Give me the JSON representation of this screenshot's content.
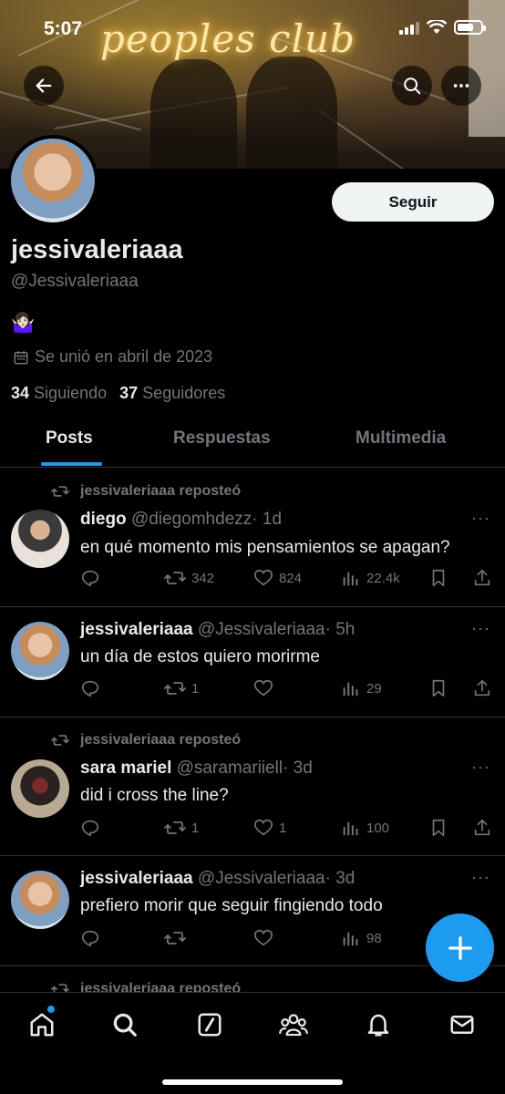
{
  "status_bar": {
    "time": "5:07"
  },
  "banner": {
    "neon_text": "peoples club"
  },
  "profile": {
    "display_name": "jessivaleriaaa",
    "handle": "@Jessivaleriaaa",
    "bio_emoji": "🤷🏻‍♀️",
    "joined": "Se unió en abril de 2023",
    "following_count": "34",
    "following_label": "Siguiendo",
    "followers_count": "37",
    "followers_label": "Seguidores",
    "follow_label": "Seguir"
  },
  "tabs": [
    {
      "label": "Posts",
      "active": true
    },
    {
      "label": "Respuestas",
      "active": false
    },
    {
      "label": "Multimedia",
      "active": false
    }
  ],
  "posts": [
    {
      "repost_by": "jessivaleriaaa reposteó",
      "name": "diego",
      "handle": "@diegomhdezz",
      "time": "· 1d",
      "text": "en qué momento mis pensamientos se apagan?",
      "replies": "",
      "reposts": "342",
      "likes": "824",
      "views": "22.4k"
    },
    {
      "repost_by": "",
      "name": "jessivaleriaaa",
      "handle": "@Jessivaleriaaa",
      "time": "· 5h",
      "text": "un día de estos quiero morirme",
      "replies": "",
      "reposts": "1",
      "likes": "",
      "views": "29"
    },
    {
      "repost_by": "jessivaleriaaa reposteó",
      "name": "sara mariel",
      "handle": "@saramariiell",
      "time": "· 3d",
      "text": "did i cross the line?",
      "replies": "",
      "reposts": "1",
      "likes": "1",
      "views": "100"
    },
    {
      "repost_by": "",
      "name": "jessivaleriaaa",
      "handle": "@Jessivaleriaaa",
      "time": "· 3d",
      "text": "prefiero morir que seguir fingiendo todo",
      "replies": "",
      "reposts": "",
      "likes": "",
      "views": "98"
    },
    {
      "repost_by": "jessivaleriaaa reposteó"
    }
  ],
  "icons": {
    "back": "arrow-left-icon",
    "search": "search-icon",
    "more": "more-horizontal-icon",
    "compose": "plus-icon",
    "home": "home-icon",
    "explore": "search-icon",
    "grok": "slash-square-icon",
    "communities": "people-icon",
    "notifications": "bell-icon",
    "messages": "envelope-icon"
  },
  "colors": {
    "accent": "#1d9bf0",
    "muted": "#71767b",
    "text": "#e7e9ea",
    "background": "#000000"
  }
}
